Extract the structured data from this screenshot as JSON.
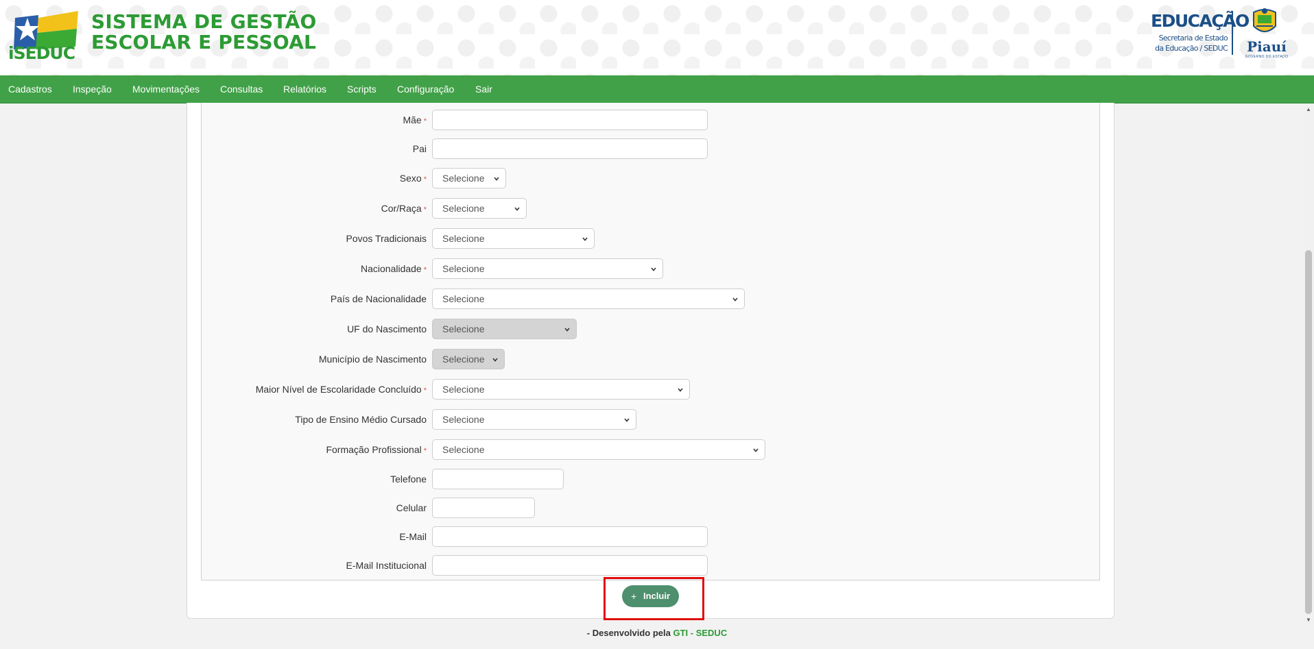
{
  "header": {
    "logo_text": "iSEDUC",
    "app_title_line1": "SISTEMA DE GESTÃO",
    "app_title_line2": "ESCOLAR E PESSOAL",
    "brand": {
      "education": "EDUCAÇÃO",
      "subtitle_line1": "Secretaria de Estado",
      "subtitle_line2": "da Educação / SEDUC",
      "state": "Piauí",
      "government": "GOVERNO DO ESTADO"
    }
  },
  "nav": {
    "items": [
      {
        "label": "Cadastros"
      },
      {
        "label": "Inspeção"
      },
      {
        "label": "Movimentações"
      },
      {
        "label": "Consultas"
      },
      {
        "label": "Relatórios"
      },
      {
        "label": "Scripts"
      },
      {
        "label": "Configuração"
      },
      {
        "label": "Sair"
      }
    ]
  },
  "form": {
    "mae": {
      "label": "Mãe",
      "required": "*",
      "value": ""
    },
    "pai": {
      "label": "Pai",
      "value": ""
    },
    "sexo": {
      "label": "Sexo",
      "required": "*",
      "selected": "Selecione"
    },
    "cor_raca": {
      "label": "Cor/Raça",
      "required": "*",
      "selected": "Selecione"
    },
    "povos": {
      "label": "Povos Tradicionais",
      "selected": "Selecione"
    },
    "nacionalidade": {
      "label": "Nacionalidade",
      "required": "*",
      "selected": "Selecione"
    },
    "pais_nacionalidade": {
      "label": "País de Nacionalidade",
      "selected": "Selecione"
    },
    "uf_nascimento": {
      "label": "UF do Nascimento",
      "selected": "Selecione"
    },
    "municipio_nascimento": {
      "label": "Município de Nascimento",
      "selected": "Selecione"
    },
    "escolaridade": {
      "label": "Maior Nível de Escolaridade Concluído",
      "required": "*",
      "selected": "Selecione"
    },
    "ensino_medio": {
      "label": "Tipo de Ensino Médio Cursado",
      "selected": "Selecione"
    },
    "formacao": {
      "label": "Formação Profissional",
      "required": "*",
      "selected": "Selecione"
    },
    "telefone": {
      "label": "Telefone",
      "value": ""
    },
    "celular": {
      "label": "Celular",
      "value": ""
    },
    "email": {
      "label": "E-Mail",
      "value": ""
    },
    "email_inst": {
      "label": "E-Mail Institucional",
      "value": ""
    }
  },
  "actions": {
    "add_icon": "+",
    "add_label": "Incluir"
  },
  "footer": {
    "prefix": "- Desenvolvido pela ",
    "highlight": "GTI - SEDUC"
  },
  "colors": {
    "nav_green": "#41a148",
    "title_green": "#2c9b34",
    "brand_blue": "#1b4f87",
    "button_green": "#4e8f6e",
    "highlight_red": "#e10d0d"
  }
}
